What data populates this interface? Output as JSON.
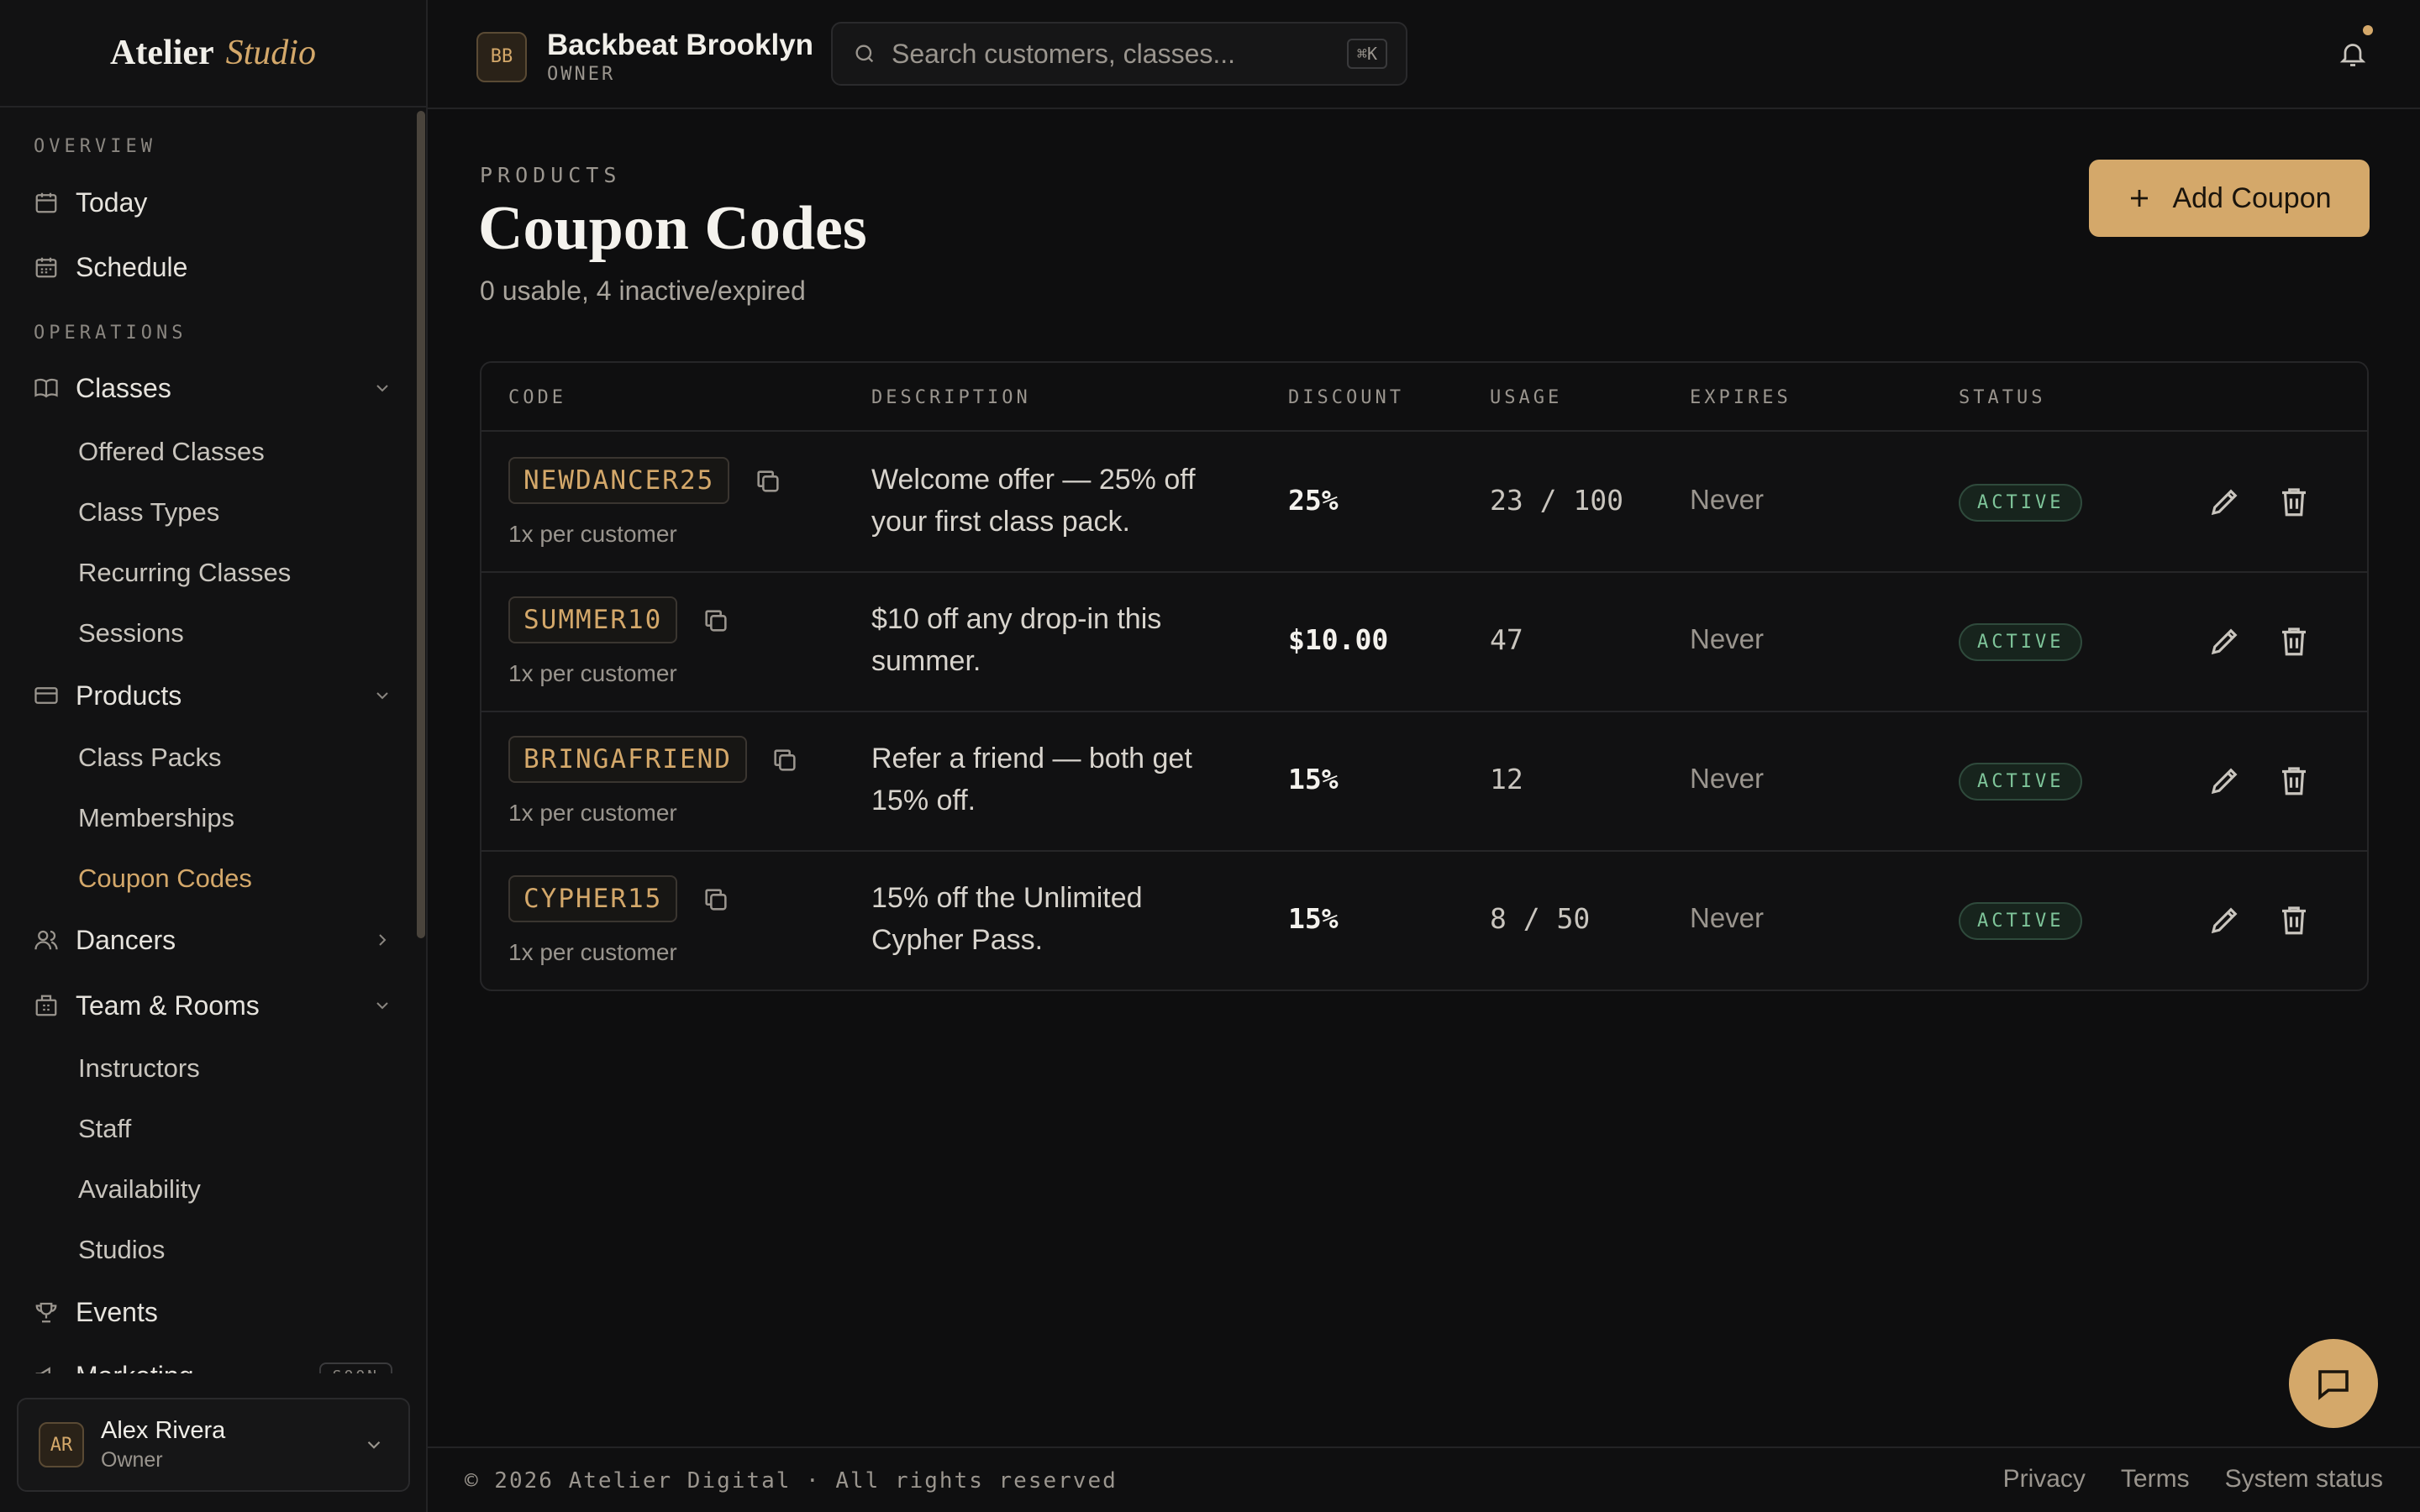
{
  "brand": {
    "name_primary": "Atelier",
    "name_secondary": "Studio"
  },
  "header": {
    "studio_initials": "BB",
    "studio_name": "Backbeat Brooklyn",
    "studio_role": "OWNER",
    "search_placeholder": "Search customers, classes...",
    "search_shortcut": "⌘K"
  },
  "sidebar": {
    "section_overview": "OVERVIEW",
    "section_operations": "OPERATIONS",
    "today": "Today",
    "schedule": "Schedule",
    "classes": "Classes",
    "classes_sub": [
      "Offered Classes",
      "Class Types",
      "Recurring Classes",
      "Sessions"
    ],
    "products": "Products",
    "products_sub": [
      "Class Packs",
      "Memberships",
      "Coupon Codes"
    ],
    "dancers": "Dancers",
    "team_rooms": "Team & Rooms",
    "team_sub": [
      "Instructors",
      "Staff",
      "Availability",
      "Studios"
    ],
    "events": "Events",
    "marketing": "Marketing",
    "soon_badge": "SOON",
    "user_initials": "AR",
    "user_name": "Alex Rivera",
    "user_role": "Owner"
  },
  "main": {
    "eyebrow": "PRODUCTS",
    "title": "Coupon Codes",
    "subtitle": "0 usable, 4 inactive/expired",
    "add_button": "Add Coupon",
    "columns": [
      "CODE",
      "DESCRIPTION",
      "DISCOUNT",
      "USAGE",
      "EXPIRES",
      "STATUS"
    ],
    "rows": [
      {
        "code": "NEWDANCER25",
        "limit": "1x per customer",
        "description": "Welcome offer — 25% off your first class pack.",
        "discount": "25%",
        "usage": "23 / 100",
        "expires": "Never",
        "status": "ACTIVE"
      },
      {
        "code": "SUMMER10",
        "limit": "1x per customer",
        "description": "$10 off any drop-in this summer.",
        "discount": "$10.00",
        "usage": "47",
        "expires": "Never",
        "status": "ACTIVE"
      },
      {
        "code": "BRINGAFRIEND",
        "limit": "1x per customer",
        "description": "Refer a friend — both get 15% off.",
        "discount": "15%",
        "usage": "12",
        "expires": "Never",
        "status": "ACTIVE"
      },
      {
        "code": "CYPHER15",
        "limit": "1x per customer",
        "description": "15% off the Unlimited Cypher Pass.",
        "discount": "15%",
        "usage": "8 / 50",
        "expires": "Never",
        "status": "ACTIVE"
      }
    ]
  },
  "footer": {
    "copyright": "© 2026 Atelier Digital · All rights reserved",
    "links": [
      "Privacy",
      "Terms",
      "System status"
    ]
  },
  "colors": {
    "accent": "#d4a86a",
    "background": "#0e0e0f",
    "status_active": "#7fc59a"
  },
  "icons": [
    "calendar-icon",
    "schedule-icon",
    "book-icon",
    "card-icon",
    "users-icon",
    "building-icon",
    "trophy-icon",
    "megaphone-icon",
    "search-icon",
    "bell-icon",
    "copy-icon",
    "pencil-icon",
    "trash-icon",
    "plus-icon",
    "chat-icon",
    "chevron-down-icon",
    "chevron-right-icon"
  ]
}
